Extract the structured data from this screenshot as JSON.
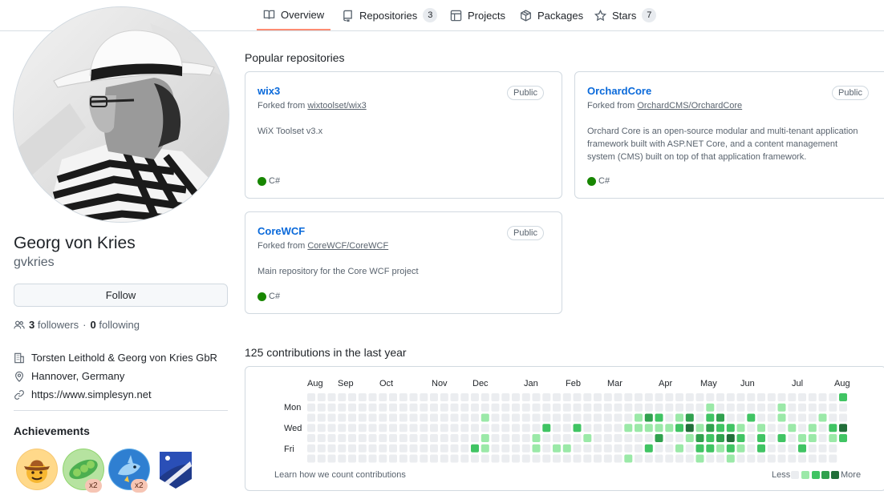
{
  "nav": {
    "tabs": [
      {
        "label": "Overview",
        "icon": "book-icon",
        "active": true
      },
      {
        "label": "Repositories",
        "icon": "repo-icon",
        "count": "3"
      },
      {
        "label": "Projects",
        "icon": "table-icon"
      },
      {
        "label": "Packages",
        "icon": "package-icon"
      },
      {
        "label": "Stars",
        "icon": "star-icon",
        "count": "7"
      }
    ]
  },
  "profile": {
    "name": "Georg von Kries",
    "login": "gvkries",
    "follow_label": "Follow",
    "followers_count": "3",
    "followers_label": "followers",
    "separator": "·",
    "following_count": "0",
    "following_label": "following",
    "company": "Torsten Leithold & Georg von Kries GbR",
    "location": "Hannover, Germany",
    "website": "https://www.simplesyn.net"
  },
  "achievements": {
    "title": "Achievements",
    "badges": [
      {
        "icon": "cowboy-hat-icon",
        "count": ""
      },
      {
        "icon": "peas-pod-icon",
        "count": "x2"
      },
      {
        "icon": "shark-icon",
        "count": "x2"
      },
      {
        "icon": "night-sky-icon",
        "count": ""
      }
    ]
  },
  "popular": {
    "title": "Popular repositories",
    "repos": [
      {
        "name": "wix3",
        "visibility": "Public",
        "forked_prefix": "Forked from",
        "forked_from": "wixtoolset/wix3",
        "description": "WiX Toolset v3.x",
        "language": "C#"
      },
      {
        "name": "OrchardCore",
        "visibility": "Public",
        "forked_prefix": "Forked from",
        "forked_from": "OrchardCMS/OrchardCore",
        "description": "Orchard Core is an open-source modular and multi-tenant application framework built with ASP.NET Core, and a content management system (CMS) built on top of that application framework.",
        "language": "C#"
      },
      {
        "name": "CoreWCF",
        "visibility": "Public",
        "forked_prefix": "Forked from",
        "forked_from": "CoreWCF/CoreWCF",
        "description": "Main repository for the Core WCF project",
        "language": "C#"
      }
    ],
    "language_color": "#178600"
  },
  "contributions": {
    "title": "125 contributions in the last year",
    "months": [
      "Aug",
      "Sep",
      "Oct",
      "Nov",
      "Dec",
      "Jan",
      "Feb",
      "Mar",
      "Apr",
      "May",
      "Jun",
      "Jul",
      "Aug"
    ],
    "weekdays": [
      "Mon",
      "Wed",
      "Fri"
    ],
    "learn_link": "Learn how we count contributions",
    "legend_less": "Less",
    "legend_more": "More",
    "colors": [
      "#ebedf0",
      "#9be9a8",
      "#40c463",
      "#30a14e",
      "#216e39"
    ],
    "cells": [
      {
        "week": 3,
        "day": 6,
        "level": 0
      },
      {
        "week": 17,
        "day": 2,
        "level": 1
      },
      {
        "week": 16,
        "day": 5,
        "level": 2
      },
      {
        "week": 17,
        "day": 4,
        "level": 1
      },
      {
        "week": 17,
        "day": 5,
        "level": 1
      },
      {
        "week": 22,
        "day": 4,
        "level": 1
      },
      {
        "week": 22,
        "day": 5,
        "level": 1
      },
      {
        "week": 23,
        "day": 3,
        "level": 2
      },
      {
        "week": 24,
        "day": 5,
        "level": 1
      },
      {
        "week": 25,
        "day": 5,
        "level": 1
      },
      {
        "week": 26,
        "day": 3,
        "level": 2
      },
      {
        "week": 27,
        "day": 4,
        "level": 1
      },
      {
        "week": 31,
        "day": 3,
        "level": 1
      },
      {
        "week": 31,
        "day": 6,
        "level": 1
      },
      {
        "week": 32,
        "day": 2,
        "level": 1
      },
      {
        "week": 32,
        "day": 3,
        "level": 1
      },
      {
        "week": 33,
        "day": 2,
        "level": 3
      },
      {
        "week": 33,
        "day": 3,
        "level": 1
      },
      {
        "week": 34,
        "day": 2,
        "level": 2
      },
      {
        "week": 34,
        "day": 3,
        "level": 1
      },
      {
        "week": 34,
        "day": 4,
        "level": 3
      },
      {
        "week": 33,
        "day": 5,
        "level": 2
      },
      {
        "week": 35,
        "day": 3,
        "level": 1
      },
      {
        "week": 36,
        "day": 2,
        "level": 1
      },
      {
        "week": 36,
        "day": 3,
        "level": 2
      },
      {
        "week": 36,
        "day": 5,
        "level": 1
      },
      {
        "week": 37,
        "day": 2,
        "level": 3
      },
      {
        "week": 37,
        "day": 3,
        "level": 4
      },
      {
        "week": 37,
        "day": 4,
        "level": 1
      },
      {
        "week": 38,
        "day": 3,
        "level": 1
      },
      {
        "week": 38,
        "day": 4,
        "level": 3
      },
      {
        "week": 38,
        "day": 5,
        "level": 2
      },
      {
        "week": 38,
        "day": 6,
        "level": 1
      },
      {
        "week": 39,
        "day": 1,
        "level": 1
      },
      {
        "week": 39,
        "day": 2,
        "level": 2
      },
      {
        "week": 39,
        "day": 3,
        "level": 3
      },
      {
        "week": 39,
        "day": 4,
        "level": 2
      },
      {
        "week": 39,
        "day": 5,
        "level": 2
      },
      {
        "week": 40,
        "day": 2,
        "level": 3
      },
      {
        "week": 40,
        "day": 3,
        "level": 2
      },
      {
        "week": 40,
        "day": 4,
        "level": 3
      },
      {
        "week": 40,
        "day": 5,
        "level": 1
      },
      {
        "week": 41,
        "day": 3,
        "level": 2
      },
      {
        "week": 41,
        "day": 4,
        "level": 4
      },
      {
        "week": 41,
        "day": 5,
        "level": 2
      },
      {
        "week": 41,
        "day": 6,
        "level": 1
      },
      {
        "week": 42,
        "day": 3,
        "level": 1
      },
      {
        "week": 42,
        "day": 4,
        "level": 2
      },
      {
        "week": 42,
        "day": 5,
        "level": 1
      },
      {
        "week": 43,
        "day": 2,
        "level": 2
      },
      {
        "week": 44,
        "day": 3,
        "level": 1
      },
      {
        "week": 44,
        "day": 4,
        "level": 2
      },
      {
        "week": 44,
        "day": 5,
        "level": 2
      },
      {
        "week": 46,
        "day": 1,
        "level": 1
      },
      {
        "week": 46,
        "day": 2,
        "level": 1
      },
      {
        "week": 46,
        "day": 4,
        "level": 2
      },
      {
        "week": 47,
        "day": 3,
        "level": 1
      },
      {
        "week": 48,
        "day": 4,
        "level": 1
      },
      {
        "week": 48,
        "day": 5,
        "level": 2
      },
      {
        "week": 49,
        "day": 3,
        "level": 1
      },
      {
        "week": 49,
        "day": 4,
        "level": 1
      },
      {
        "week": 50,
        "day": 2,
        "level": 1
      },
      {
        "week": 51,
        "day": 3,
        "level": 2
      },
      {
        "week": 51,
        "day": 4,
        "level": 1
      },
      {
        "week": 52,
        "day": 0,
        "level": 2
      },
      {
        "week": 52,
        "day": 3,
        "level": 4
      },
      {
        "week": 52,
        "day": 4,
        "level": 2
      }
    ]
  }
}
